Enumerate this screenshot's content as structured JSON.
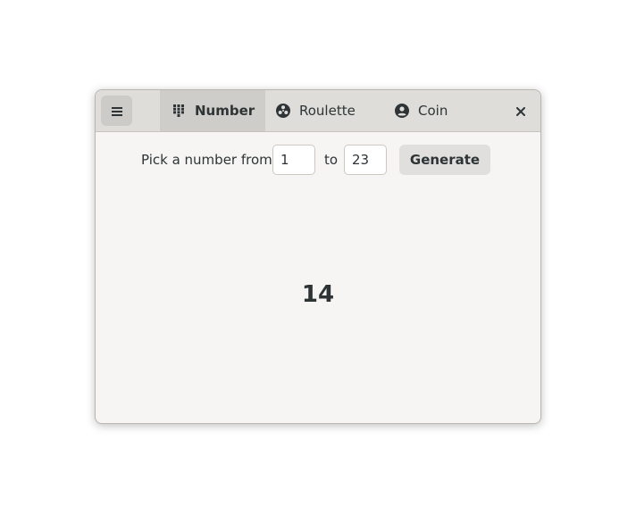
{
  "tabs": [
    {
      "label": "Number",
      "icon": "dialpad-icon",
      "active": true
    },
    {
      "label": "Roulette",
      "icon": "roulette-icon",
      "active": false
    },
    {
      "label": "Coin",
      "icon": "coin-icon",
      "active": false
    }
  ],
  "header": {
    "menu_icon": "hamburger-menu-icon",
    "close_icon": "close-icon"
  },
  "range": {
    "from_label": "Pick a number from",
    "to_label": "to",
    "from_value": "1",
    "to_value": "23",
    "generate_label": "Generate"
  },
  "result": "14",
  "colors": {
    "window_bg": "#f6f5f4",
    "headerbar_bg": "#deddda",
    "active_tab_bg": "#cfcdca",
    "text": "#2e3436"
  }
}
